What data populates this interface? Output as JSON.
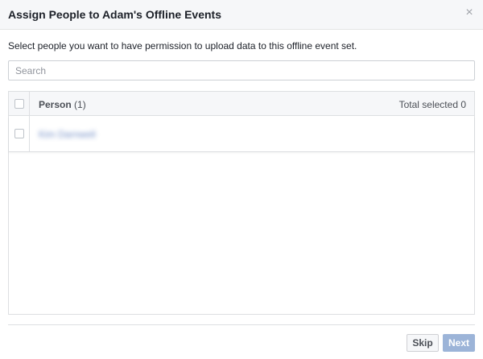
{
  "dialog": {
    "title": "Assign People to Adam's Offline Events",
    "close_glyph": "×",
    "description": "Select people you want to have permission to upload data to this offline event set."
  },
  "search": {
    "placeholder": "Search",
    "value": ""
  },
  "table": {
    "header_person_label": "Person",
    "header_person_count": "(1)",
    "header_total_selected": "Total selected 0",
    "rows": [
      {
        "name": "Kim Darnwell",
        "checked": false
      }
    ]
  },
  "footer": {
    "skip_label": "Skip",
    "next_label": "Next"
  },
  "colors": {
    "accent": "#4267b2",
    "next_disabled": "#9cb4d8",
    "header_bg": "#f6f7f9"
  },
  "icons": {
    "close": "close-icon"
  }
}
